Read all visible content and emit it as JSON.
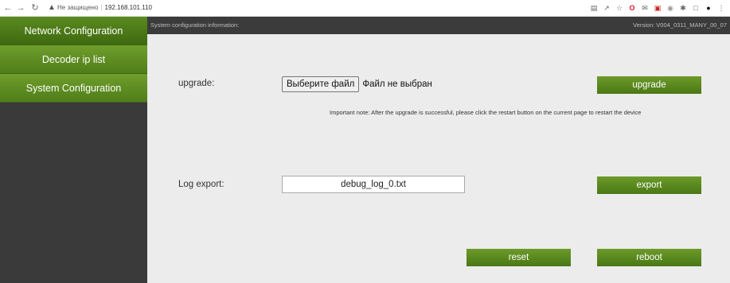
{
  "browser": {
    "security_label": "Не защищено",
    "url": "192.168.101.110",
    "extensions": [
      "translate-icon",
      "share-icon",
      "star-icon",
      "opera-icon",
      "mail-icon",
      "screenshot-icon",
      "dot-icon",
      "puzzle-icon",
      "sidebar-icon",
      "profile-icon",
      "menu-icon"
    ]
  },
  "sidebar": {
    "items": [
      {
        "label": "Network Configuration",
        "active": true
      },
      {
        "label": "Decoder ip list",
        "active": false
      },
      {
        "label": "System Configuration",
        "active": false
      }
    ]
  },
  "header": {
    "title": "System configuration information:",
    "version": "Version: V004_0311_MANY_00_07"
  },
  "upgrade": {
    "label": "upgrade:",
    "file_button": "Выберите файл",
    "file_status": "Файл не выбран",
    "button": "upgrade",
    "note": "Important note: After the upgrade is successful, please click the restart button on the current page to restart the device"
  },
  "log": {
    "label": "Log export:",
    "value": "debug_log_0.txt",
    "button": "export"
  },
  "actions": {
    "reset": "reset",
    "reboot": "reboot"
  },
  "colors": {
    "accent_green": "#5b8a20",
    "sidebar_bg": "#3a3a3a",
    "content_bg": "#ececec"
  }
}
